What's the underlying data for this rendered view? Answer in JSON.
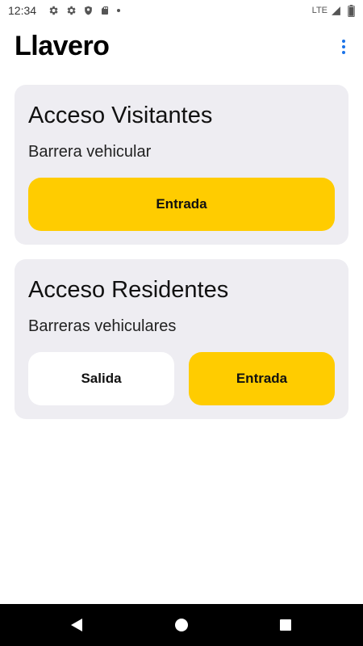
{
  "status_bar": {
    "time": "12:34",
    "network": "LTE",
    "icons": [
      "settings-icon",
      "settings-icon",
      "shield-icon",
      "sd-card-icon",
      "notification-dot-icon",
      "signal-icon",
      "battery-icon"
    ]
  },
  "app_bar": {
    "title": "Llavero",
    "menu_icon": "more-vert-icon"
  },
  "cards": [
    {
      "title": "Acceso Visitantes",
      "subtitle": "Barrera vehicular",
      "buttons": [
        {
          "label": "Entrada",
          "style": "primary"
        }
      ]
    },
    {
      "title": "Acceso Residentes",
      "subtitle": "Barreras vehiculares",
      "buttons": [
        {
          "label": "Salida",
          "style": "secondary"
        },
        {
          "label": "Entrada",
          "style": "primary"
        }
      ]
    }
  ],
  "nav_bar": {
    "icons": [
      "back-icon",
      "home-icon",
      "recents-icon"
    ]
  },
  "colors": {
    "accent": "#ffcc00",
    "card_background": "#eeedf2",
    "menu_icon": "#1a73e8",
    "nav_background": "#000000"
  }
}
